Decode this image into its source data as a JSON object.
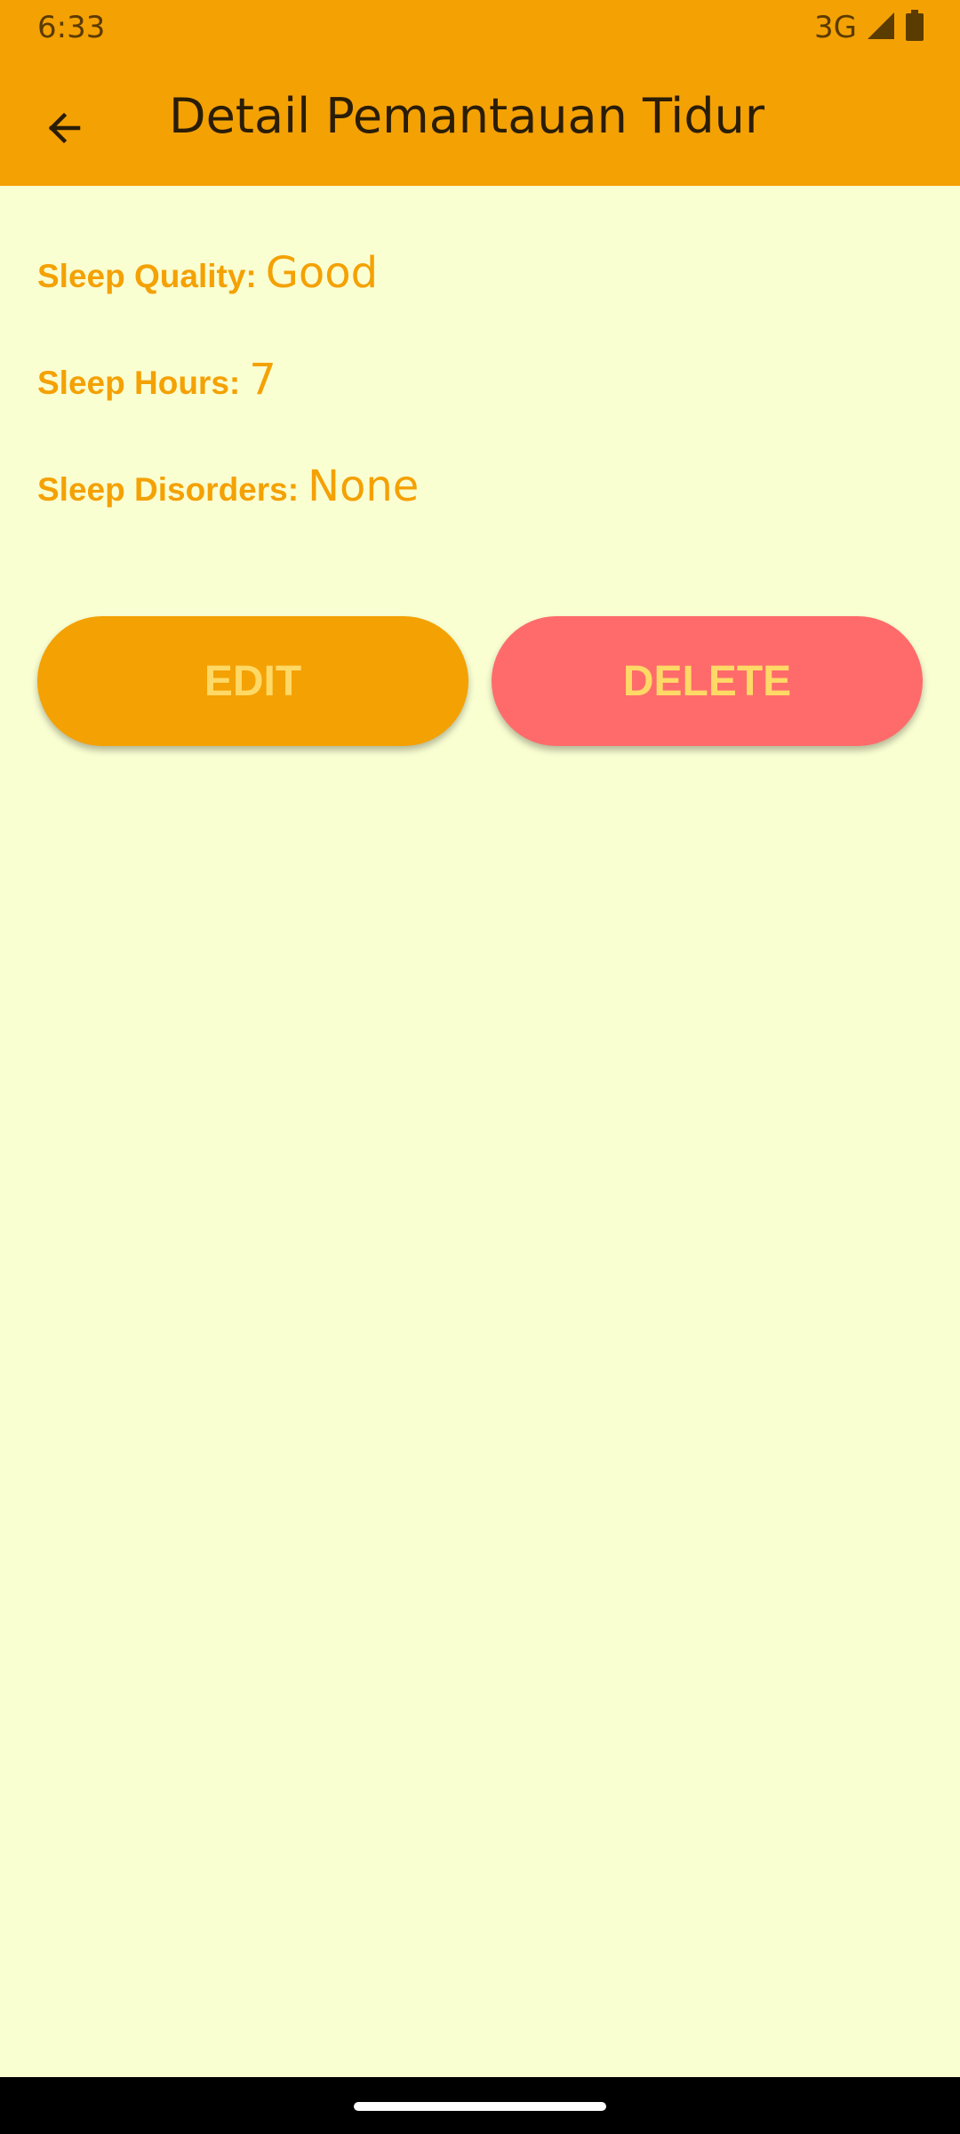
{
  "status_bar": {
    "time": "6:33",
    "network": "3G",
    "icons": [
      "signal-icon",
      "battery-icon"
    ]
  },
  "app_bar": {
    "back_icon": "arrow-left-icon",
    "title": "Detail Pemantauan Tidur"
  },
  "details": {
    "quality_label": "Sleep Quality:",
    "quality_value": "Good",
    "hours_label": "Sleep Hours:",
    "hours_value": "7",
    "disorders_label": "Sleep Disorders:",
    "disorders_value": "None"
  },
  "actions": {
    "edit_label": "EDIT",
    "delete_label": "DELETE"
  },
  "colors": {
    "primary": "#F4A104",
    "background": "#FAFFD2",
    "delete": "#FF6B6B",
    "button_text": "#FFD966"
  }
}
